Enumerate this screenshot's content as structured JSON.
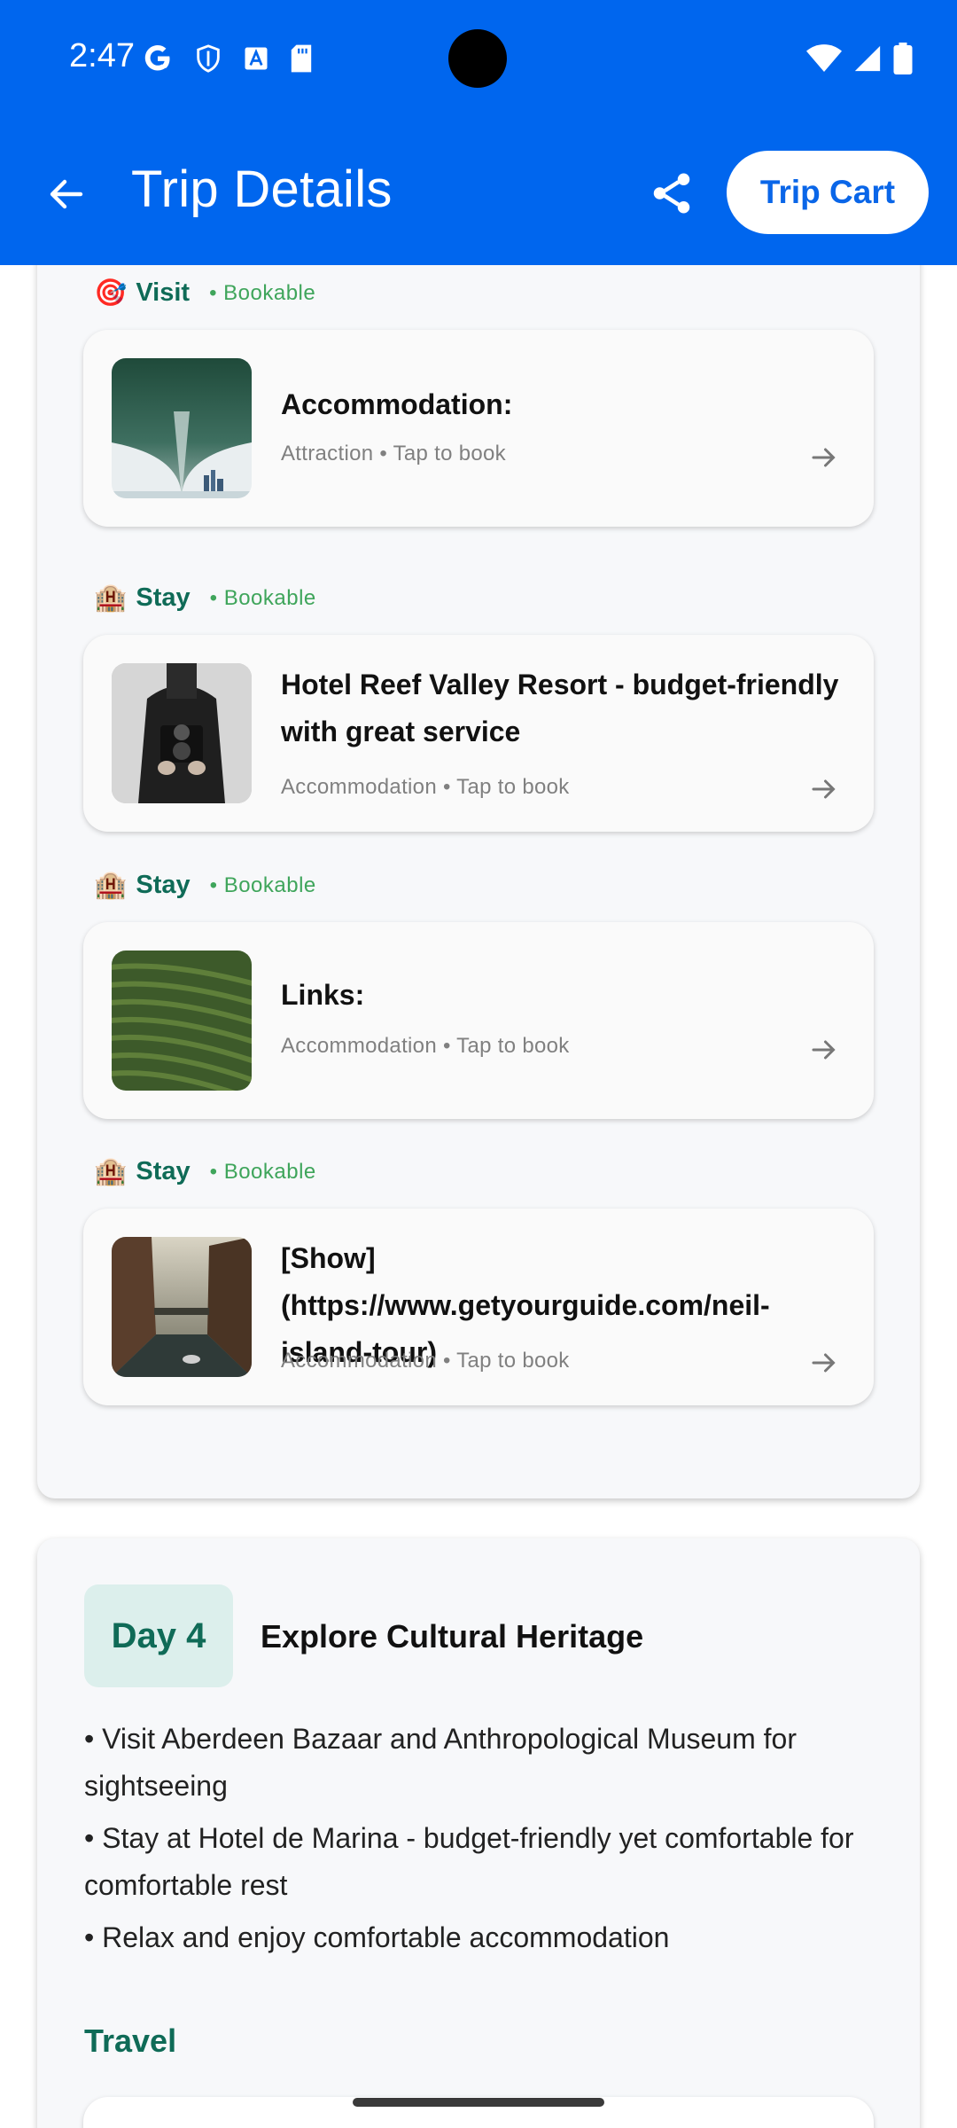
{
  "status_bar": {
    "time": "2:47",
    "icons_left": [
      "google-icon",
      "shield-icon",
      "a-box-icon",
      "sdcard-icon"
    ],
    "icons_right": [
      "wifi-icon",
      "signal-icon",
      "battery-icon"
    ]
  },
  "app_bar": {
    "title": "Trip Details",
    "cart_label": "Trip Cart",
    "background_color": "#0066ee"
  },
  "items": [
    {
      "emoji": "🎯",
      "kind": "Visit",
      "bookable": "• Bookable",
      "title": "Accommodation:",
      "subtitle": "Attraction • Tap to book"
    },
    {
      "emoji": "🏨",
      "kind": "Stay",
      "bookable": "• Bookable",
      "title": "Hotel Reef Valley Resort - budget-friendly with great service",
      "subtitle": "Accommodation • Tap to book"
    },
    {
      "emoji": "🏨",
      "kind": "Stay",
      "bookable": "• Bookable",
      "title": "Links:",
      "subtitle": "Accommodation • Tap to book"
    },
    {
      "emoji": "🏨",
      "kind": "Stay",
      "bookable": "• Bookable",
      "title": "[Show](https://www.getyourguide.com/neil-island-tour)",
      "subtitle": "Accommodation • Tap to book"
    }
  ],
  "day4": {
    "badge": "Day 4",
    "title": "Explore Cultural Heritage",
    "bullets": [
      "• Visit Aberdeen Bazaar and Anthropological Museum for sightseeing",
      "• Stay at Hotel de Marina - budget-friendly yet comfortable for comfortable rest",
      "• Relax and enjoy comfortable accommodation"
    ],
    "travel_label": "Travel"
  }
}
